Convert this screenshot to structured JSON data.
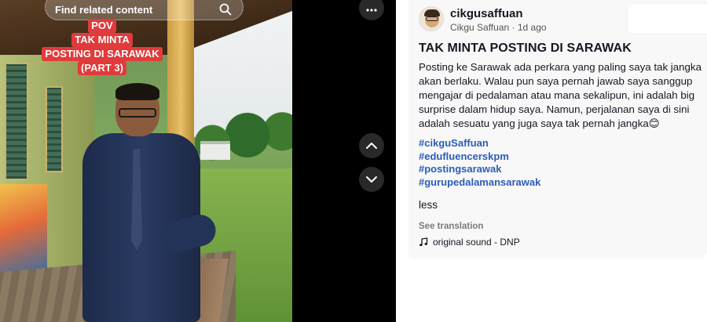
{
  "search": {
    "placeholder": "Find related content"
  },
  "video": {
    "overlay_lines": [
      "POV",
      "TAK MINTA",
      "POSTING DI SARAWAK",
      "(PART 3)"
    ]
  },
  "controls": {
    "more_icon": "ellipsis-icon",
    "up_icon": "chevron-up-icon",
    "down_icon": "chevron-down-icon"
  },
  "post": {
    "username": "cikgusaffuan",
    "display_name": "Cikgu Saffuan",
    "separator": " · ",
    "time_ago": "1d ago",
    "title": "TAK MINTA POSTING DI SARAWAK",
    "description": "Posting ke Sarawak ada perkara yang paling saya tak jangka akan berlaku. Walau pun saya pernah jawab saya sanggup mengajar di pedalaman atau mana sekalipun, ini adalah big surprise dalam hidup saya. Namun, perjalanan saya di sini adalah sesuatu yang juga saya tak pernah jangka😊",
    "hashtags": [
      "#cikguSaffuan",
      "#edufluencerskpm",
      "#postingsarawak",
      "#gurupedalamansarawak"
    ],
    "less_label": "less",
    "see_translation": "See translation",
    "sound": "original sound - DNP",
    "sound_icon": "music-note-icon"
  },
  "colors": {
    "overlay_red": "#e23b3b",
    "hashtag_blue": "#2b5db9",
    "card_bg": "#f8f8f8"
  }
}
